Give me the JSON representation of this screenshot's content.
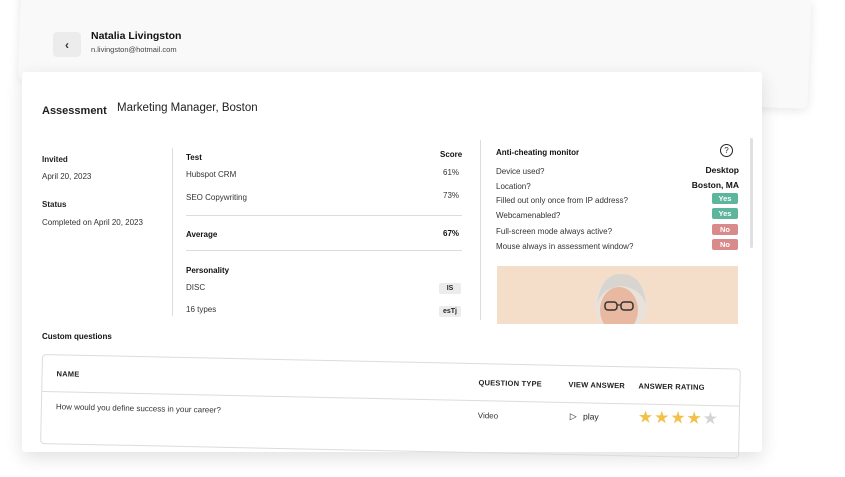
{
  "candidate": {
    "name": "Natalia Livingston",
    "email": "n.livingston@hotmail.com"
  },
  "assessment": {
    "label": "Assessment",
    "role": "Marketing Manager, Boston"
  },
  "details": {
    "invited_label": "Invited",
    "invited_value": "April 20, 2023",
    "status_label": "Status",
    "status_value": "Completed on April 20, 2023"
  },
  "tests": {
    "header_test": "Test",
    "header_score": "Score",
    "rows": [
      {
        "name": "Hubspot CRM",
        "score": "61%"
      },
      {
        "name": "SEO Copywriting",
        "score": "73%"
      }
    ],
    "average_label": "Average",
    "average_value": "67%"
  },
  "personality": {
    "title": "Personality",
    "rows": [
      {
        "name": "DISC",
        "value": "IS"
      },
      {
        "name": "16 types",
        "value": "esTj"
      }
    ]
  },
  "anti_cheating": {
    "title": "Anti-cheating monitor",
    "help_symbol": "?",
    "rows": [
      {
        "label": "Device used?",
        "value": "Desktop",
        "kind": "text"
      },
      {
        "label": "Location?",
        "value": "Boston, MA",
        "kind": "text"
      },
      {
        "label": "Filled out only once from IP address?",
        "value": "Yes",
        "kind": "yes"
      },
      {
        "label": "Webcamenabled?",
        "value": "Yes",
        "kind": "yes"
      },
      {
        "label": "Full-screen mode always active?",
        "value": "No",
        "kind": "no"
      },
      {
        "label": "Mouse always in assessment window?",
        "value": "No",
        "kind": "no"
      }
    ],
    "colors": {
      "yes": "#5cb59c",
      "no": "#d98a8a"
    }
  },
  "custom_questions": {
    "title": "Custom questions",
    "columns": [
      "NAME",
      "QUESTION TYPE",
      "VIEW ANSWER",
      "ANSWER RATING"
    ],
    "rows": [
      {
        "name": "How would you define success in your career?",
        "type": "Video",
        "answer_label": "play",
        "rating": 4,
        "rating_max": 5
      }
    ],
    "star_color": "#f2c14a",
    "star_empty_color": "#d4d4d4"
  }
}
